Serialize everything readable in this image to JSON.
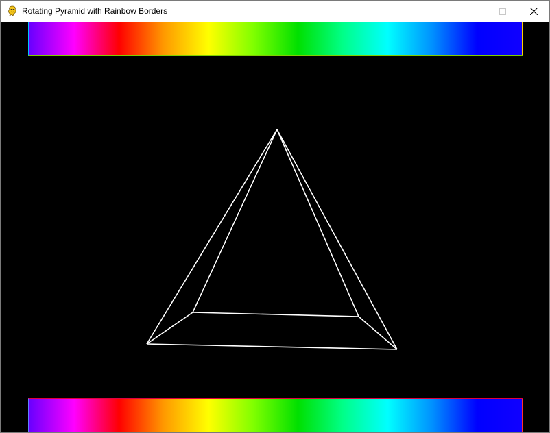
{
  "window": {
    "title": "Rotating Pyramid with Rainbow Borders",
    "icon": "pygame-snake-icon"
  },
  "controls": {
    "minimize_icon": "minimize-icon",
    "maximize_icon": "maximize-icon",
    "close_icon": "close-icon"
  },
  "canvas": {
    "background": "#000000",
    "wireframe_color": "#ffffff",
    "rainbow_stops": [
      "#6a00ff",
      "#ff00ff",
      "#ff0000",
      "#ff9900",
      "#ffff00",
      "#80ff00",
      "#00e000",
      "#00ff88",
      "#00ffff",
      "#0090ff",
      "#0000ff",
      "#1000ff"
    ]
  }
}
